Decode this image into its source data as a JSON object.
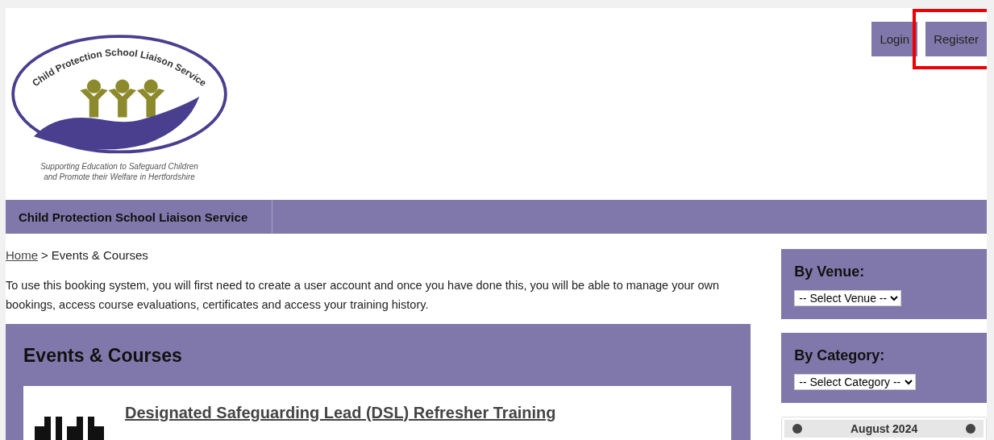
{
  "header": {
    "logo": {
      "ring_text": "Child Protection School Liaison Service",
      "tagline": [
        "Supporting Education to Safeguard Children",
        "and Promote their Welfare in Hertfordshire"
      ]
    },
    "buttons": [
      {
        "label": "Login",
        "highlighted": false
      },
      {
        "label": "Register",
        "highlighted": true
      }
    ]
  },
  "nav": {
    "items": [
      "Child Protection School Liaison Service"
    ]
  },
  "breadcrumb": {
    "link": "Home",
    "separator": ">",
    "current": "Events & Courses"
  },
  "intro": "To use this booking system, you will first need to create a user account and once you have done this, you will be able to manage your own bookings, access course evaluations, certificates and access your training history.",
  "events": {
    "title": "Events & Courses",
    "courses": [
      {
        "title": "Designated Safeguarding Lead (DSL) Refresher Training"
      }
    ]
  },
  "sidebar": {
    "filters": [
      {
        "title": "By Venue:",
        "placeholder": "-- Select Venue --"
      },
      {
        "title": "By Category:",
        "placeholder": "-- Select Category --"
      }
    ],
    "calendar": {
      "month": "August 2024"
    }
  }
}
